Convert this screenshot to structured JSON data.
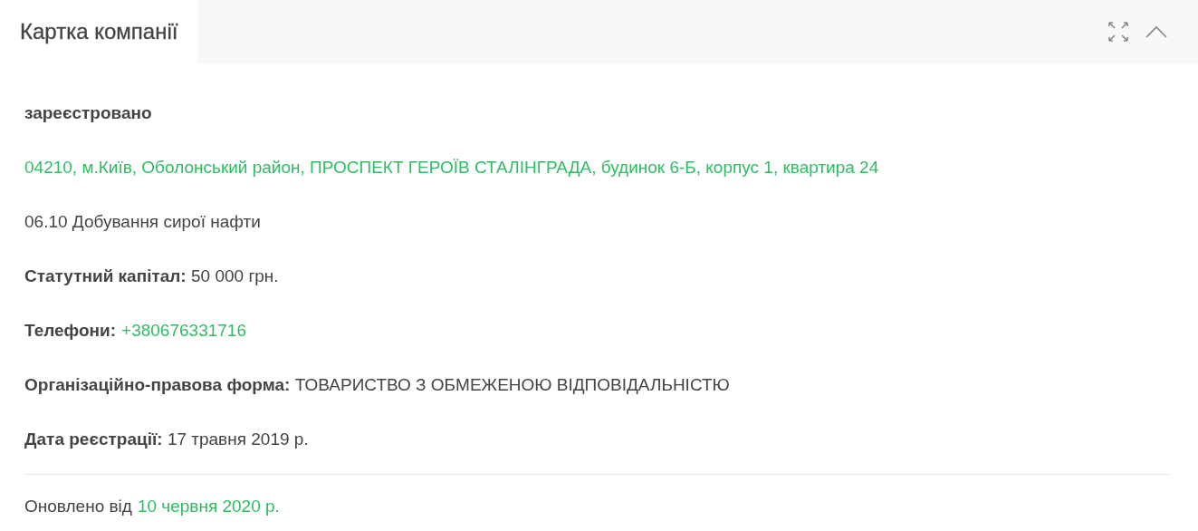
{
  "panel": {
    "title": "Картка компанії"
  },
  "rows": [
    {
      "kind": "status",
      "text": "зареєстровано"
    },
    {
      "kind": "link",
      "text": "04210, м.Київ, Оболонський район, ПРОСПЕКТ ГЕРОЇВ СТАЛІНГРАДА, будинок 6-Б, корпус 1, квартира 24"
    },
    {
      "kind": "text",
      "text": "06.10 Добування сирої нафти"
    },
    {
      "kind": "field",
      "label": "Статутний капітал:",
      "value": "50 000 грн."
    },
    {
      "kind": "phone",
      "label": "Телефони:",
      "value": "+380676331716"
    },
    {
      "kind": "field",
      "label": "Організаційно-правова форма:",
      "value": "ТОВАРИСТВО З ОБМЕЖЕНОЮ ВІДПОВІДАЛЬНІСТЮ"
    },
    {
      "kind": "field",
      "label": "Дата реєстрації:",
      "value": "17 травня 2019 р."
    }
  ],
  "footer": {
    "label": "Оновлено від",
    "date": "10 червня 2020 р."
  }
}
